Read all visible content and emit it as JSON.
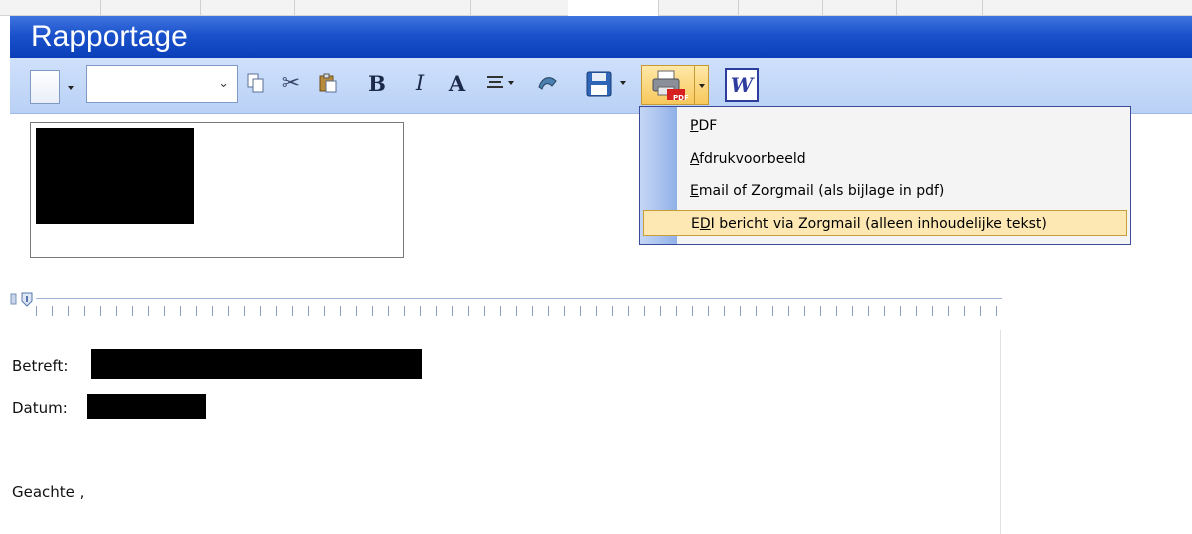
{
  "window": {
    "title": "Rapportage"
  },
  "toolbar": {
    "font_value": "",
    "bold_label": "B",
    "italic_label": "I",
    "font_color_label": "A",
    "word_label": "W",
    "print_badge": "PDF"
  },
  "icons": {
    "new": "new-document-icon",
    "copy": "copy-icon",
    "cut": "scissors-icon",
    "paste": "paste-icon",
    "align": "align-icon",
    "link": "link-icon",
    "save": "floppy-disk-icon",
    "print": "printer-pdf-icon",
    "word": "word-icon"
  },
  "menu": {
    "items": [
      {
        "label": "PDF",
        "highlighted": false
      },
      {
        "label": "Afdrukvoorbeeld",
        "highlighted": false
      },
      {
        "label": "Email  of  Zorgmail (als bijlage in pdf)",
        "highlighted": false
      },
      {
        "label": "EDI bericht via Zorgmail (alleen inhoudelijke tekst)",
        "highlighted": true
      }
    ]
  },
  "document": {
    "betreft_label": "Betreft:",
    "datum_label": "Datum:",
    "greeting": "Geachte ,"
  },
  "colors": {
    "title_bar": "#1b52cc",
    "toolbar": "#c3d8f8",
    "menu_highlight": "#fde8b4",
    "menu_border": "#3b4a9a"
  }
}
